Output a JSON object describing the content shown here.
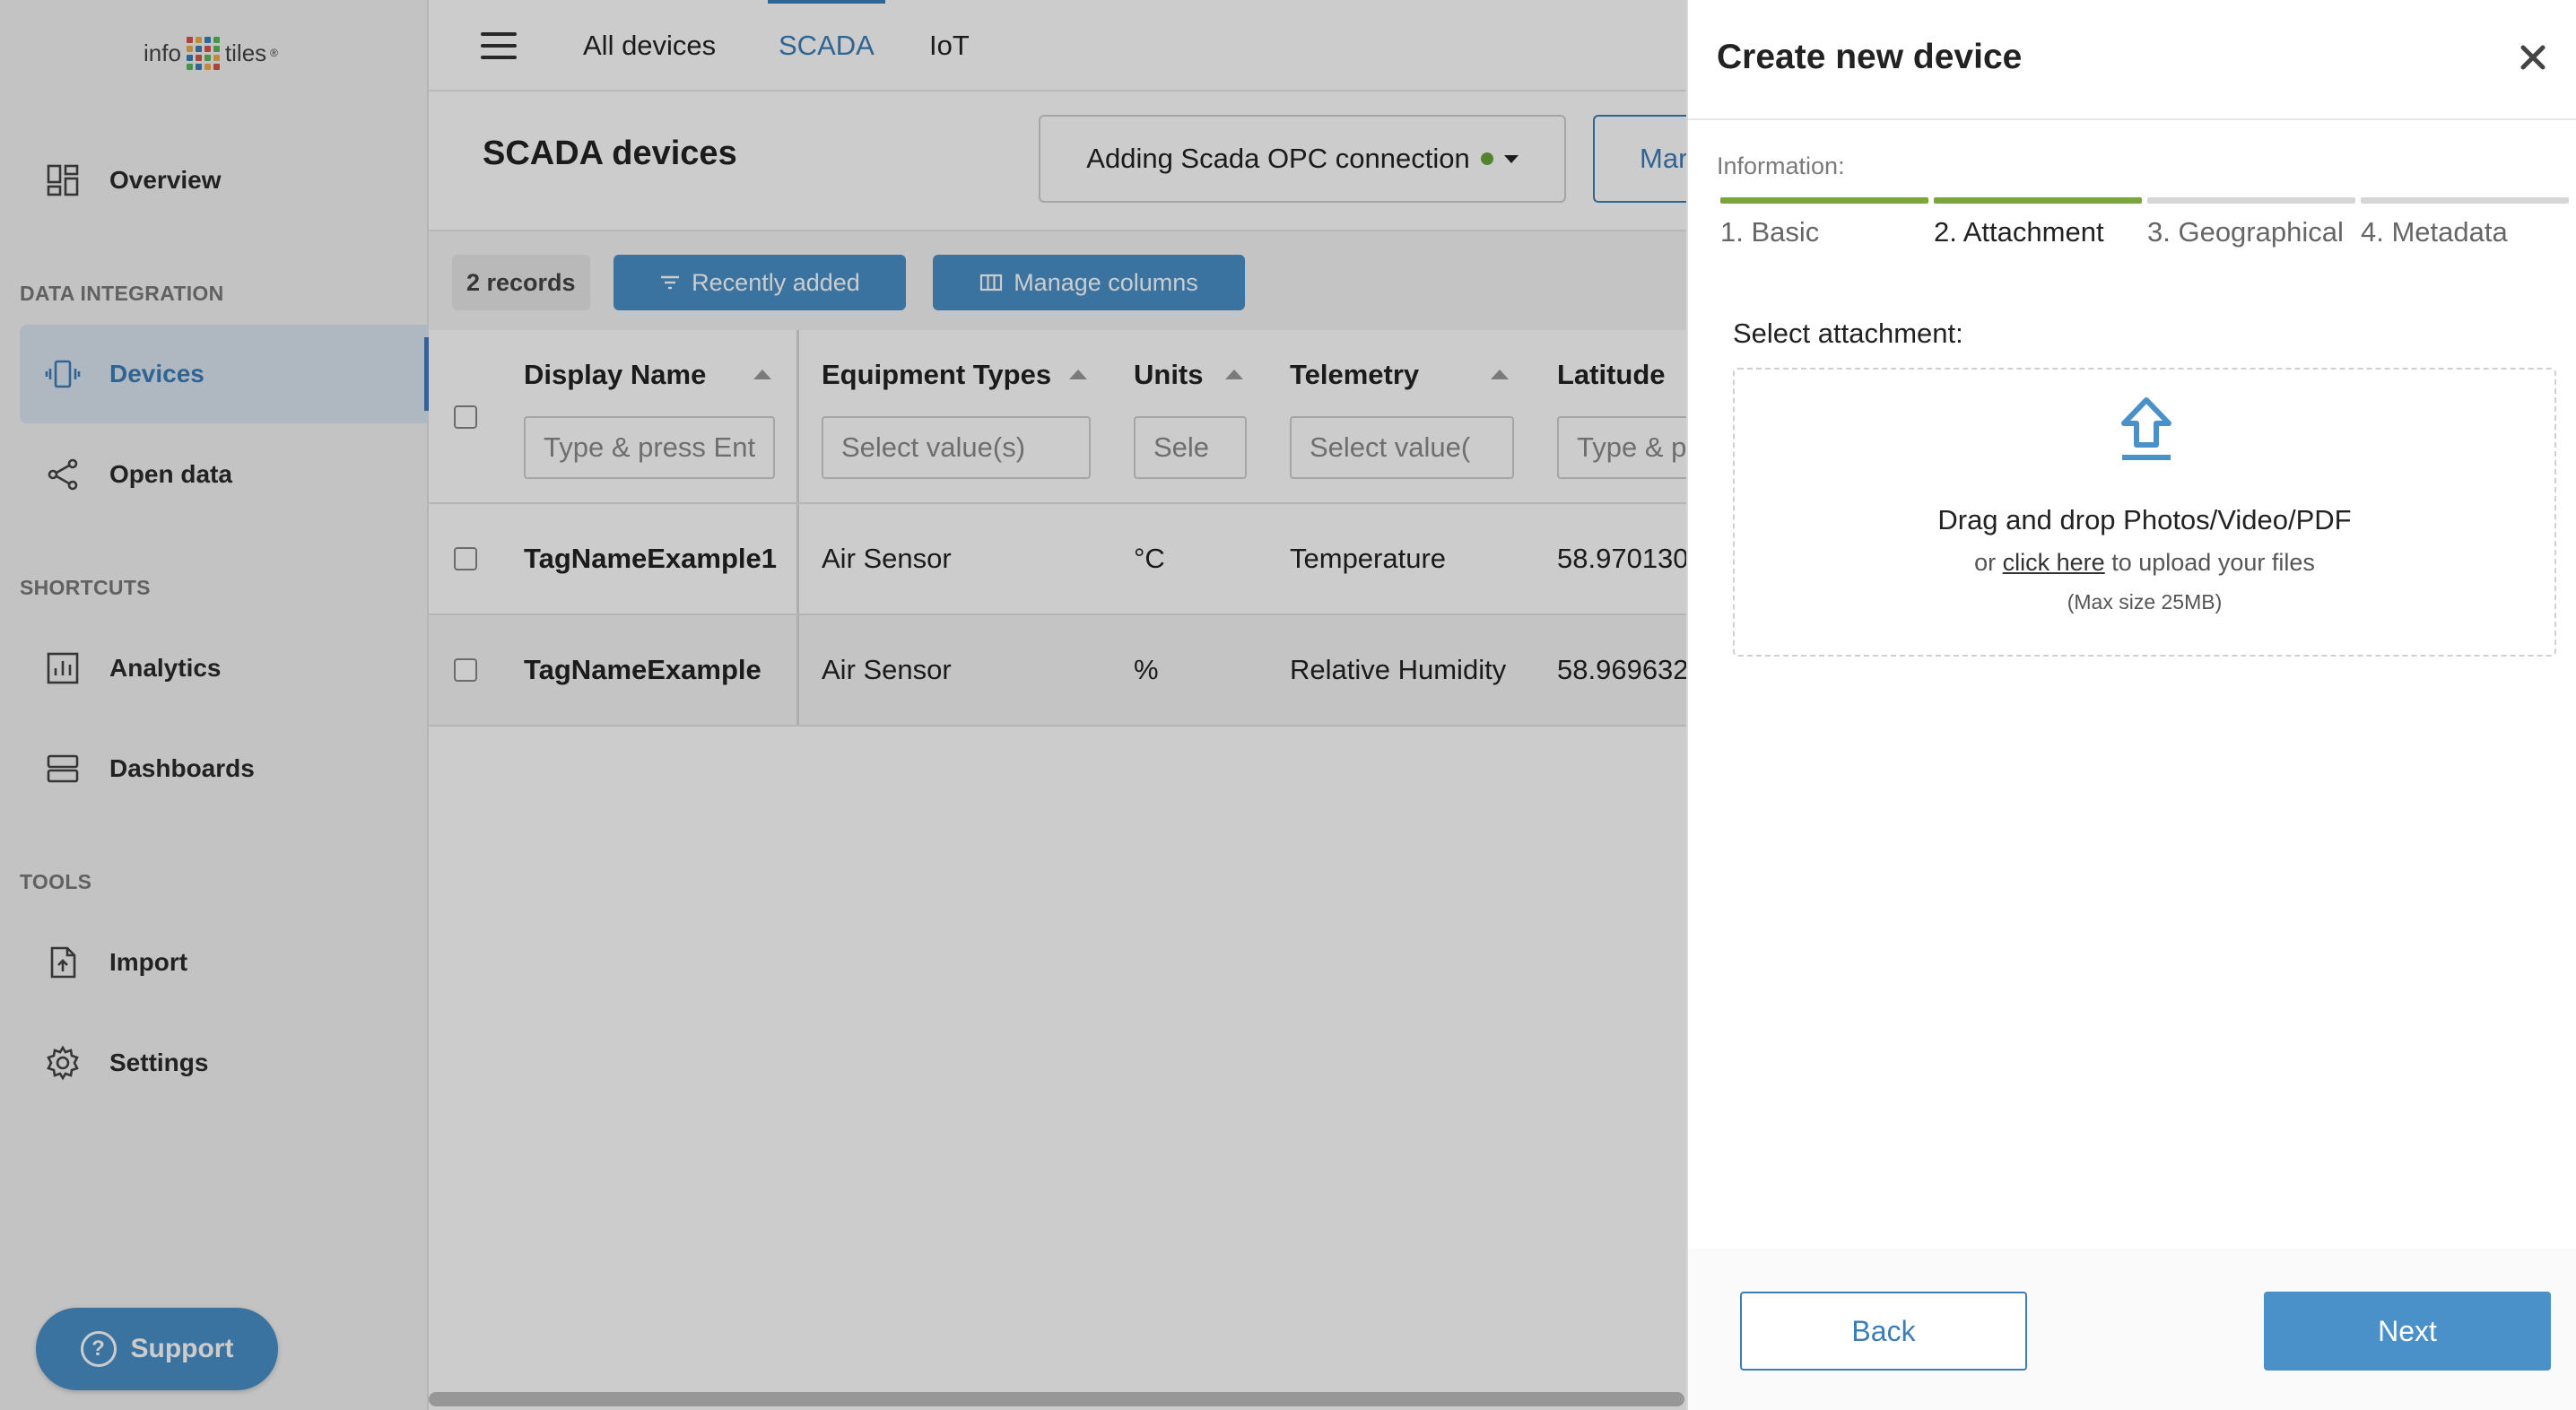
{
  "brand": {
    "logo_left": "info",
    "logo_right": "tiles",
    "logo_mark": "®",
    "dot_colors": [
      "#d9534f",
      "#f0ad4e",
      "#3c7db7",
      "#5cb85c",
      "#f0ad4e",
      "#3c7db7",
      "#d9534f",
      "#5cb85c",
      "#3c7db7",
      "#d9534f",
      "#5cb85c",
      "#f0ad4e",
      "#5cb85c",
      "#3c7db7",
      "#f0ad4e",
      "#d9534f"
    ]
  },
  "sidebar": {
    "overview": "Overview",
    "section_data_integration": "DATA INTEGRATION",
    "devices": "Devices",
    "open_data": "Open data",
    "section_shortcuts": "SHORTCUTS",
    "analytics": "Analytics",
    "dashboards": "Dashboards",
    "section_tools": "TOOLS",
    "import": "Import",
    "settings": "Settings",
    "support": "Support"
  },
  "topbar": {
    "tabs": [
      "All devices",
      "SCADA",
      "IoT"
    ],
    "active_tab": "SCADA"
  },
  "page": {
    "title": "SCADA devices",
    "connection_select": "Adding Scada OPC connection",
    "connection_status_color": "#6aa33a",
    "manage_button_partial": "Mar"
  },
  "toolbar": {
    "records": "2 records",
    "recently_added": "Recently added",
    "manage_columns": "Manage columns"
  },
  "table": {
    "columns": [
      {
        "label": "Display Name",
        "placeholder": "Type & press Ent"
      },
      {
        "label": "Equipment Types",
        "placeholder": "Select value(s)"
      },
      {
        "label": "Units",
        "placeholder": "Sele"
      },
      {
        "label": "Telemetry",
        "placeholder": "Select value("
      },
      {
        "label": "Latitude",
        "placeholder": "Type & p"
      }
    ],
    "rows": [
      {
        "name": "TagNameExample1",
        "equipment": "Air Sensor",
        "units": "°C",
        "telemetry": "Temperature",
        "latitude": "58.970130"
      },
      {
        "name": "TagNameExample",
        "equipment": "Air Sensor",
        "units": "%",
        "telemetry": "Relative Humidity",
        "latitude": "58.969632"
      }
    ]
  },
  "drawer": {
    "title": "Create new device",
    "info_label": "Information:",
    "steps": [
      "1. Basic",
      "2. Attachment",
      "3. Geographical",
      "4. Metadata"
    ],
    "current_step": 2,
    "step_done_color": "#7aa63a",
    "select_attachment": "Select attachment:",
    "dropzone": {
      "title": "Drag and drop Photos/Video/PDF",
      "or": "or",
      "link": "click here",
      "suffix": "to upload your files",
      "max": "(Max size 25MB)"
    },
    "back": "Back",
    "next": "Next"
  },
  "colors": {
    "accent": "#3c7db7",
    "accent_button": "#4a90c9"
  }
}
